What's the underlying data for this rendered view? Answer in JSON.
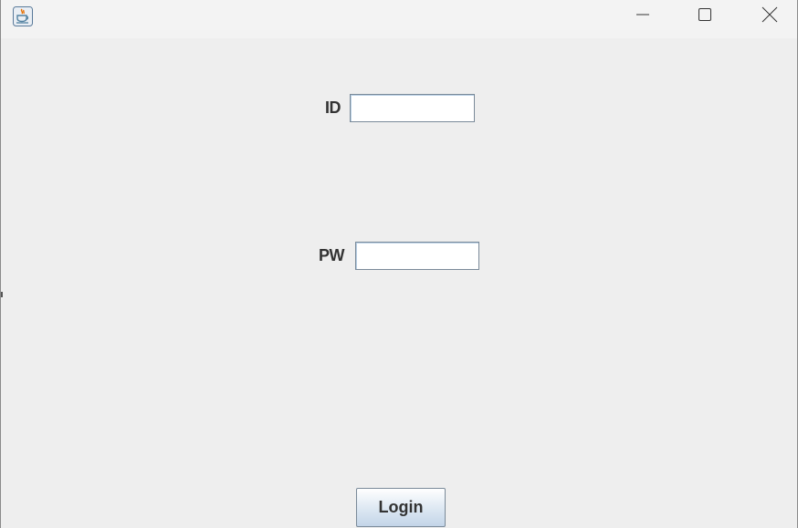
{
  "window": {
    "title": "",
    "icons": {
      "app": "java-cup-icon",
      "minimize": "minimize-icon",
      "maximize": "maximize-icon",
      "close": "close-icon"
    }
  },
  "form": {
    "id_label": "ID",
    "id_value": "",
    "pw_label": "PW",
    "pw_value": "",
    "login_label": "Login"
  },
  "colors": {
    "background": "#eeeeee",
    "titlebar": "#f3f3f3",
    "field_border": "#7a8a99",
    "button_gradient_top": "#ffffff",
    "button_gradient_bottom": "#c3d5e8"
  }
}
